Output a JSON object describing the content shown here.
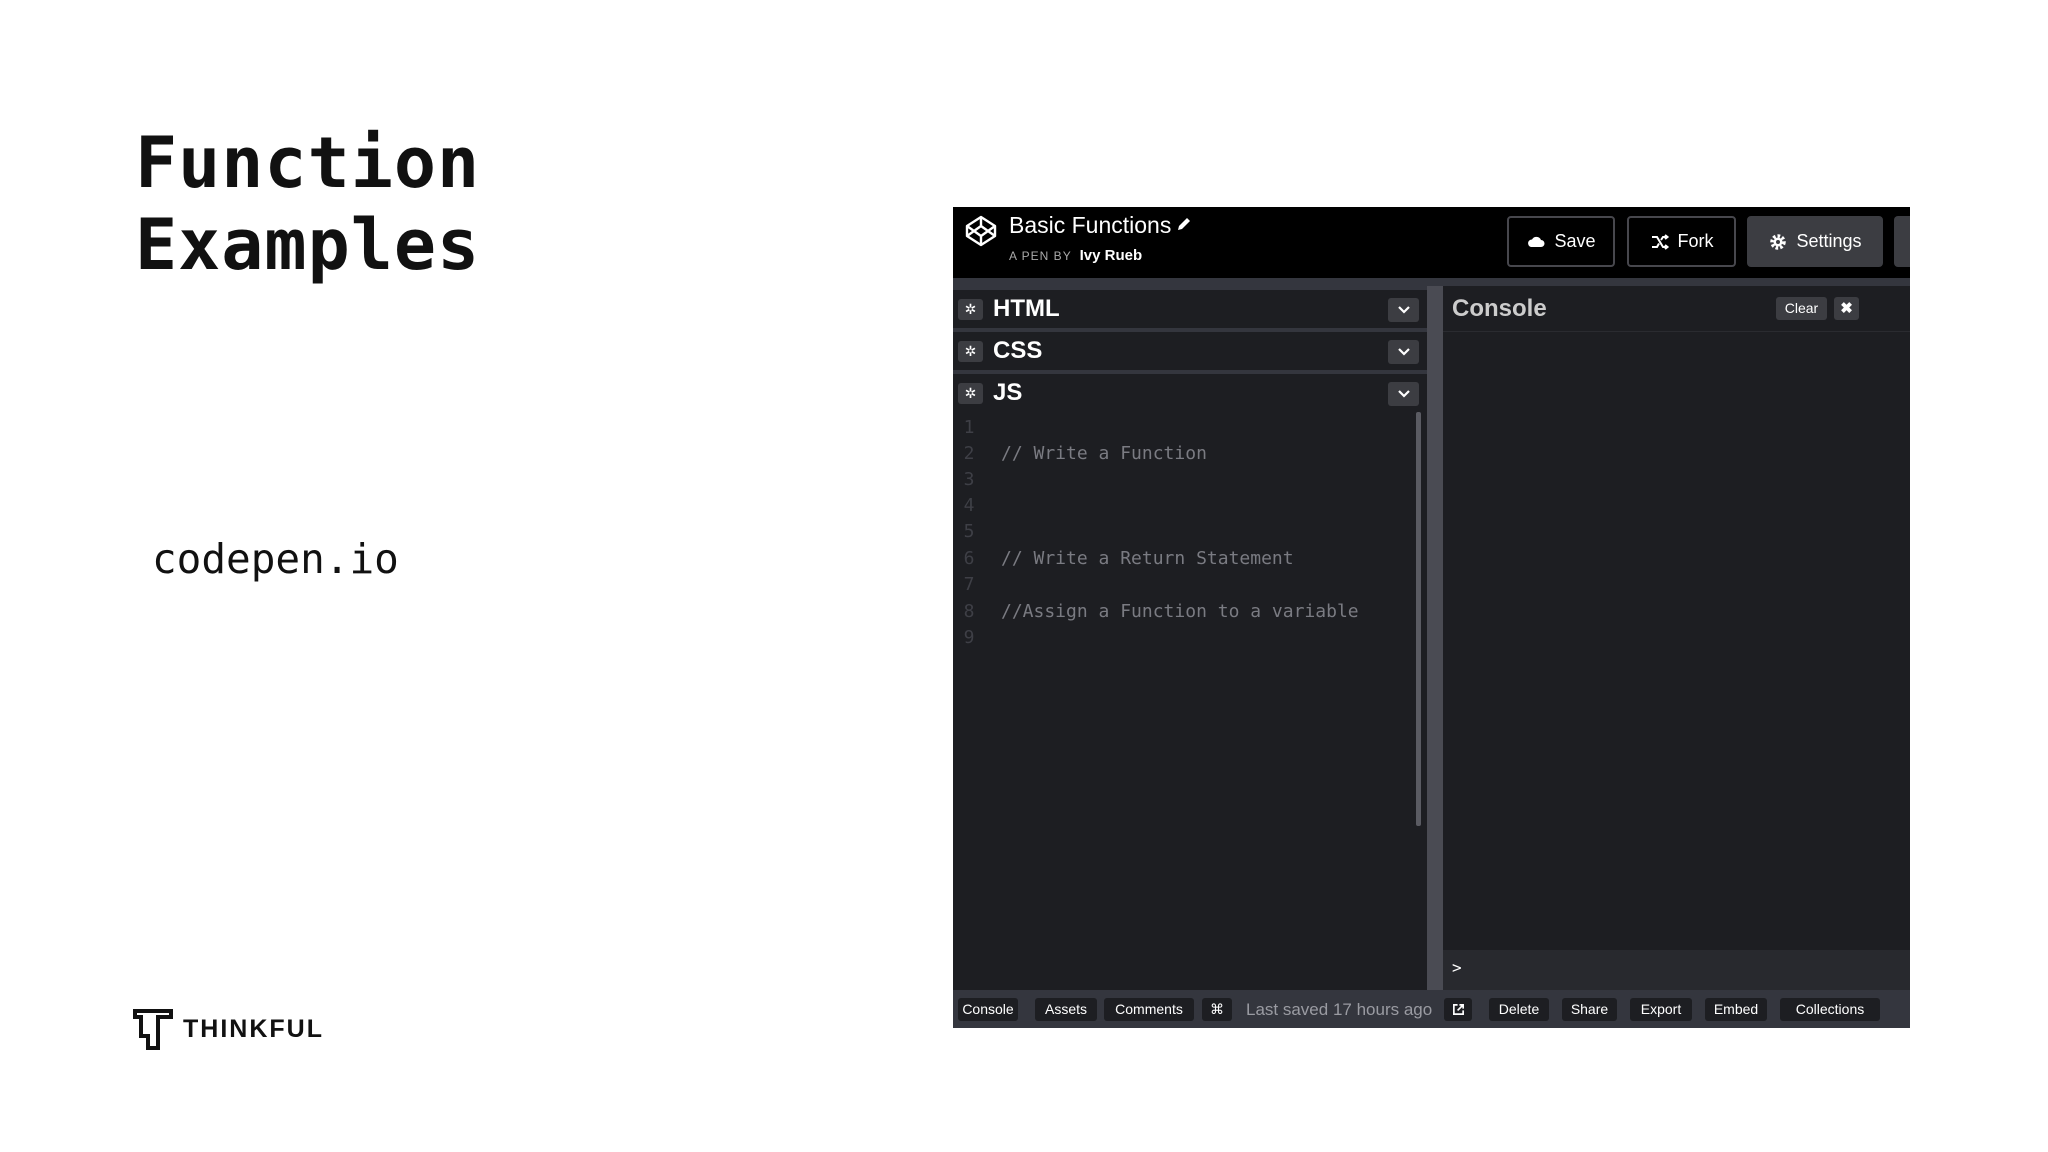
{
  "slide": {
    "title_line1": "Function",
    "title_line2": "Examples",
    "url": "codepen.io",
    "logo_text": "THINKFUL"
  },
  "codepen": {
    "pen_title": "Basic Functions",
    "author_label": "A PEN BY",
    "author_name": "Ivy Rueb",
    "buttons": {
      "save": "Save",
      "fork": "Fork",
      "settings": "Settings"
    },
    "editors": [
      {
        "label": "HTML"
      },
      {
        "label": "CSS"
      },
      {
        "label": "JS"
      }
    ],
    "code_lines": [
      {
        "num": "1",
        "text": ""
      },
      {
        "num": "2",
        "text": "// Write a Function"
      },
      {
        "num": "3",
        "text": ""
      },
      {
        "num": "4",
        "text": ""
      },
      {
        "num": "5",
        "text": ""
      },
      {
        "num": "6",
        "text": "// Write a Return Statement"
      },
      {
        "num": "7",
        "text": ""
      },
      {
        "num": "8",
        "text": "//Assign a Function to a variable"
      },
      {
        "num": "9",
        "text": ""
      }
    ],
    "console": {
      "title": "Console",
      "clear": "Clear",
      "close": "✖",
      "prompt": ">"
    },
    "footer": {
      "console": "Console",
      "assets": "Assets",
      "comments": "Comments",
      "shortcut": "⌘",
      "status": "Last saved 17 hours ago",
      "delete": "Delete",
      "share": "Share",
      "export": "Export",
      "embed": "Embed",
      "collections": "Collections"
    }
  },
  "colors": {
    "header_bg": "#000000",
    "editor_bg": "#1d1e22",
    "divider": "#34363e",
    "button_bg": "#3c3d42"
  }
}
